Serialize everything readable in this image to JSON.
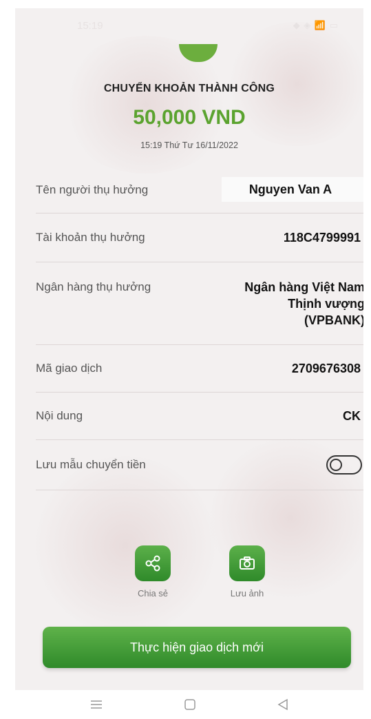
{
  "status_bar": {
    "time": "15:19",
    "icons": "◆ ◈ 📶 ▭"
  },
  "receipt": {
    "title": "CHUYỂN KHOẢN THÀNH CÔNG",
    "amount": "50,000 VND",
    "datetime": "15:19 Thứ Tư 16/11/2022"
  },
  "details": {
    "beneficiary_name": {
      "label": "Tên người thụ hưởng",
      "value": "Nguyen Van A"
    },
    "beneficiary_account": {
      "label": "Tài khoản thụ hưởng",
      "value": "118C4799991"
    },
    "beneficiary_bank": {
      "label": "Ngân hàng thụ hưởng",
      "value_lines": [
        "Ngân hàng Việt Nam",
        "Thịnh vượng",
        "(VPBANK)"
      ]
    },
    "transaction_id": {
      "label": "Mã giao dịch",
      "value": "2709676308"
    },
    "content": {
      "label": "Nội dung",
      "value": "CK"
    },
    "save_template": {
      "label": "Lưu mẫu chuyển tiền",
      "enabled": false
    }
  },
  "actions": {
    "share_label": "Chia sẻ",
    "save_image_label": "Lưu ảnh",
    "new_transaction_label": "Thực hiện giao dịch mới"
  },
  "colors": {
    "accent": "#5ba32f",
    "button": "#3a9430"
  }
}
